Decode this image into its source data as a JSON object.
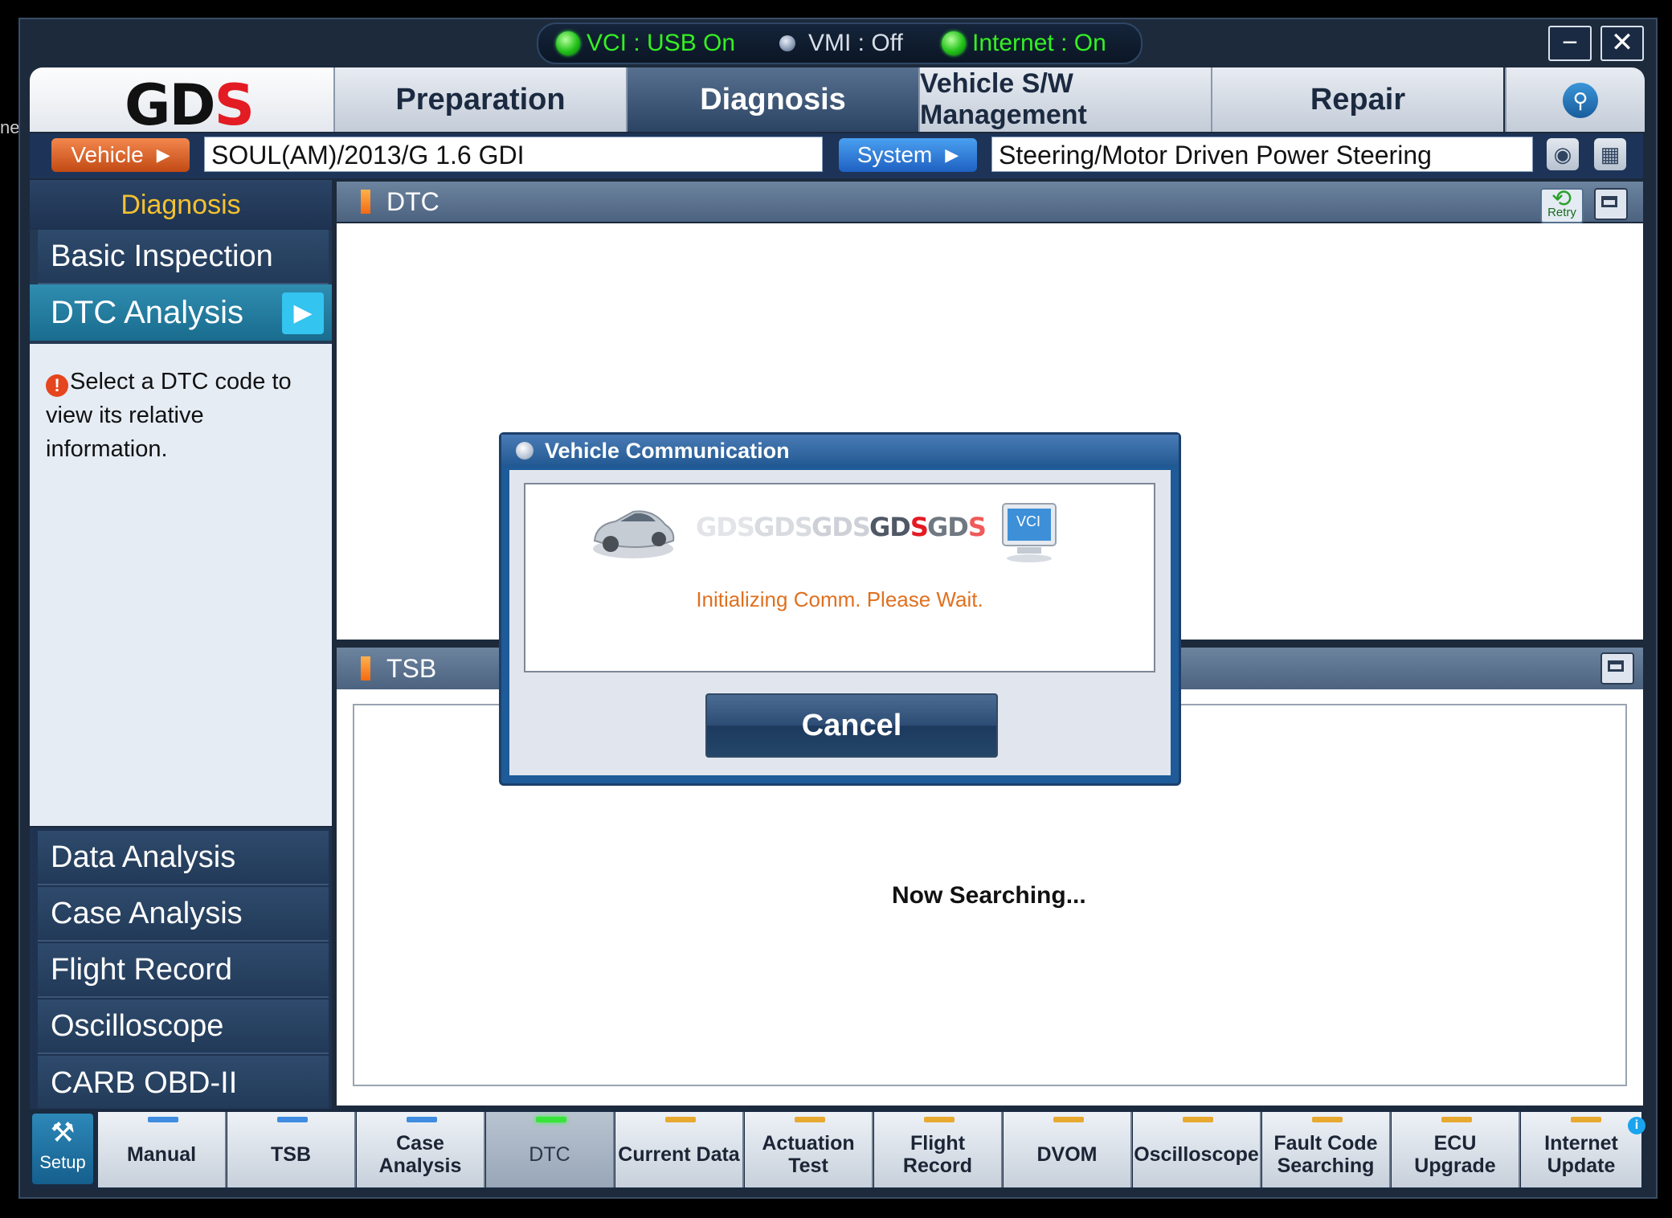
{
  "status": {
    "vci": "VCI : USB On",
    "vmi": "VMI : Off",
    "internet": "Internet : On"
  },
  "window_controls": {
    "minimize": "−",
    "close": "✕"
  },
  "tabs": [
    {
      "label": "Preparation"
    },
    {
      "label": "Diagnosis",
      "active": true
    },
    {
      "label": "Vehicle S/W Management"
    },
    {
      "label": "Repair"
    }
  ],
  "vehicle_bar": {
    "vehicle_label": "Vehicle",
    "vehicle_value": "SOUL(AM)/2013/G 1.6 GDI",
    "system_label": "System",
    "system_value": "Steering/Motor Driven Power Steering"
  },
  "sidebar": {
    "header": "Diagnosis",
    "items_top": [
      "Basic Inspection",
      "DTC Analysis"
    ],
    "info": "Select a DTC code to view its relative information.",
    "items_bottom": [
      "Data Analysis",
      "Case Analysis",
      "Flight Record",
      "Oscilloscope",
      "CARB OBD-II"
    ]
  },
  "panels": {
    "dtc_title": "DTC",
    "retry_label": "Retry",
    "tsb_title": "TSB",
    "tsb_status": "Now Searching..."
  },
  "dialog": {
    "title": "Vehicle Communication",
    "vci_label": "VCI",
    "message": "Initializing Comm. Please Wait.",
    "cancel": "Cancel"
  },
  "toolbar": {
    "setup": "Setup",
    "items": [
      {
        "label": "Manual"
      },
      {
        "label": "TSB"
      },
      {
        "label": "Case Analysis"
      },
      {
        "label": "DTC",
        "active": true
      },
      {
        "label": "Current Data"
      },
      {
        "label": "Actuation Test"
      },
      {
        "label": "Flight Record"
      },
      {
        "label": "DVOM"
      },
      {
        "label": "Oscilloscope"
      },
      {
        "label": "Fault Code Searching"
      },
      {
        "label": "ECU Upgrade"
      },
      {
        "label": "Internet Update"
      }
    ]
  },
  "colors": {
    "active_tab": "#2c4464",
    "vehicle_button": "#e0642a",
    "system_button": "#2a74d8",
    "dialog_message": "#e0701f",
    "sidebar_header": "#f4c130",
    "led_on": "#34f023"
  }
}
